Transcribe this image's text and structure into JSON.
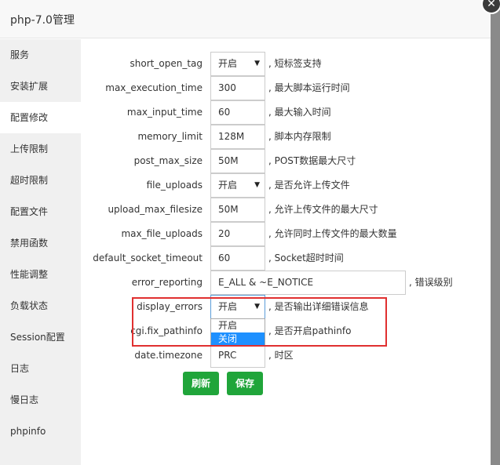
{
  "dialog": {
    "title": "php-7.0管理",
    "close_glyph": "✕"
  },
  "sidebar": {
    "items": [
      {
        "label": "服务",
        "active": false
      },
      {
        "label": "安装扩展",
        "active": false
      },
      {
        "label": "配置修改",
        "active": true
      },
      {
        "label": "上传限制",
        "active": false
      },
      {
        "label": "超时限制",
        "active": false
      },
      {
        "label": "配置文件",
        "active": false
      },
      {
        "label": "禁用函数",
        "active": false
      },
      {
        "label": "性能调整",
        "active": false
      },
      {
        "label": "负载状态",
        "active": false
      },
      {
        "label": "Session配置",
        "active": false
      },
      {
        "label": "日志",
        "active": false
      },
      {
        "label": "慢日志",
        "active": false
      },
      {
        "label": "phpinfo",
        "active": false
      }
    ]
  },
  "settings": [
    {
      "key": "short_open_tag",
      "type": "select",
      "value": "开启",
      "desc": ", 短标签支持"
    },
    {
      "key": "max_execution_time",
      "type": "input",
      "value": "300",
      "desc": ", 最大脚本运行时间"
    },
    {
      "key": "max_input_time",
      "type": "input",
      "value": "60",
      "desc": ", 最大输入时间"
    },
    {
      "key": "memory_limit",
      "type": "input",
      "value": "128M",
      "desc": ", 脚本内存限制"
    },
    {
      "key": "post_max_size",
      "type": "input",
      "value": "50M",
      "desc": ", POST数据最大尺寸"
    },
    {
      "key": "file_uploads",
      "type": "select",
      "value": "开启",
      "desc": ", 是否允许上传文件"
    },
    {
      "key": "upload_max_filesize",
      "type": "input",
      "value": "50M",
      "desc": ", 允许上传文件的最大尺寸"
    },
    {
      "key": "max_file_uploads",
      "type": "input",
      "value": "20",
      "desc": ", 允许同时上传文件的最大数量"
    },
    {
      "key": "default_socket_timeout",
      "type": "input",
      "value": "60",
      "desc": ", Socket超时时间"
    },
    {
      "key": "error_reporting",
      "type": "wide",
      "value": "E_ALL & ~E_NOTICE",
      "desc": ", 错误级别"
    },
    {
      "key": "display_errors",
      "type": "select",
      "value": "开启",
      "desc": ", 是否输出详细错误信息"
    },
    {
      "key": "cgi.fix_pathinfo",
      "type": "select",
      "value": "",
      "desc": ", 是否开启pathinfo"
    },
    {
      "key": "date.timezone",
      "type": "input",
      "value": "PRC",
      "desc": ", 时区"
    }
  ],
  "dropdown": {
    "options": [
      "开启",
      "关闭"
    ],
    "highlighted": "关闭"
  },
  "buttons": {
    "refresh": "刷新",
    "save": "保存"
  },
  "colors": {
    "accent": "#20a53a",
    "highlight": "#1e90ff",
    "annotation": "#e03030"
  }
}
